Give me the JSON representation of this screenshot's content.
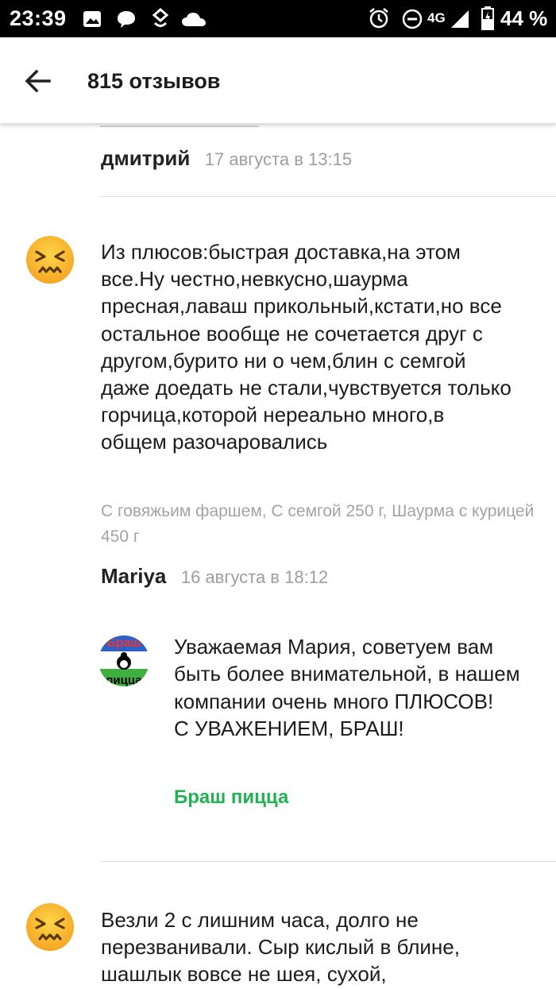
{
  "status_bar": {
    "time": "23:39",
    "network": "4G",
    "battery": "44 %"
  },
  "app_bar": {
    "title": "815 отзывов",
    "back_icon": "arrow-left-icon"
  },
  "previous_review": {
    "author": "дмитрий",
    "date": "17 августа в 13:15"
  },
  "reviews": [
    {
      "rating_icon": "confounded-face-icon",
      "text": "Из плюсов:быстрая доставка,на этом все.Ну честно,невкусно,шаурма пресная,лаваш прикольный,кстати,но все остальное вообще не сочетается друг с другом,бурито ни о чем,блин с семгой даже доедать не стали,чувствуется только горчица,которой нереально много,в общем разочаровались",
      "products": "С говяжьим фаршем, С семгой 250 г, Шаурма с курицей 450 г",
      "author": "Mariya",
      "date": "16 августа в 18:12",
      "reply": {
        "text": "Уважаемая Мария, советуем вам быть более внимательной, в нашем компании очень много ПЛЮСОВ!\nС УВАЖЕНИЕМ, БРАШ!",
        "author": "Браш пицца",
        "logo_text_top": "Браш",
        "logo_text_bottom": "пицца"
      }
    },
    {
      "rating_icon": "confounded-face-icon",
      "text": "Везли 2 с лишним часа, долго не перезванивали. Сыр кислый в блине, шашлык вовсе не шея, сухой,"
    }
  ]
}
